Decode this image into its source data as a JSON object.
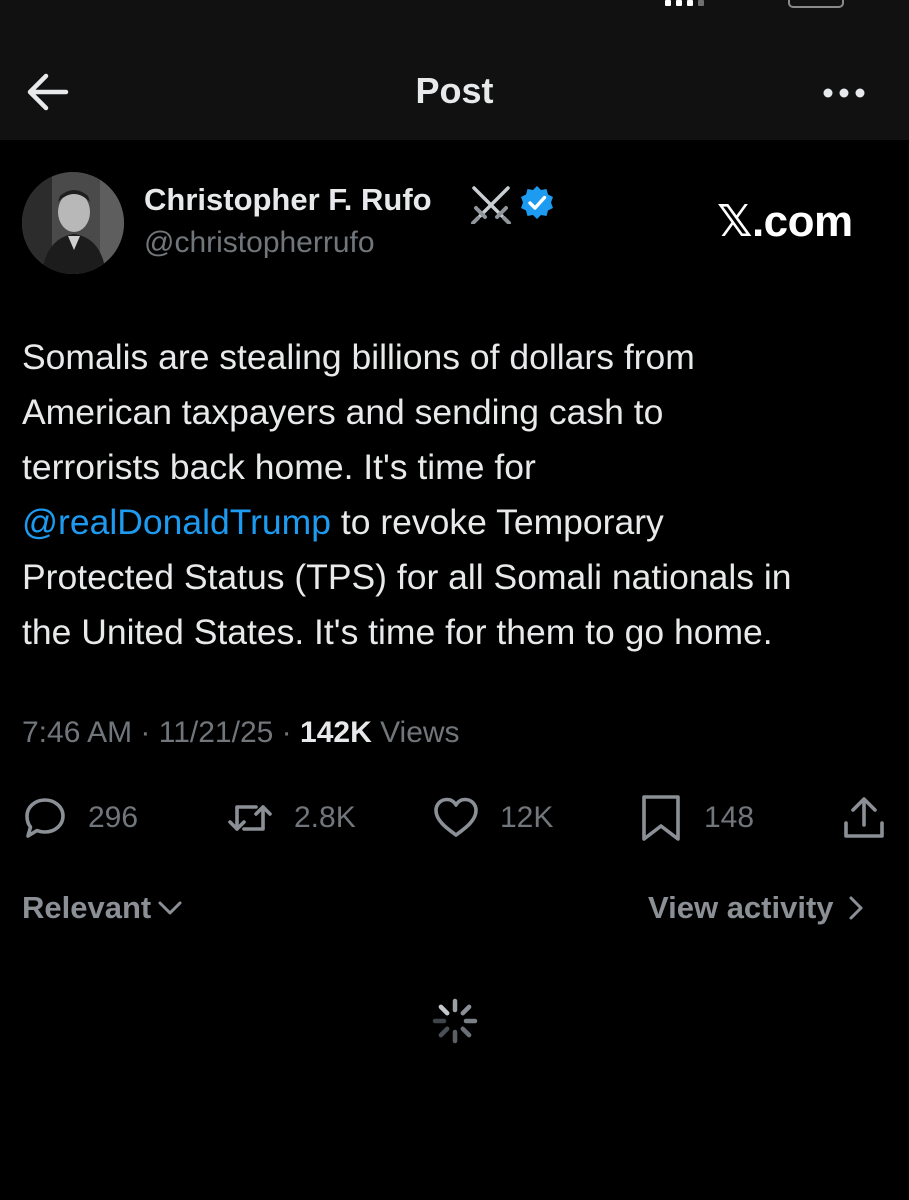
{
  "header": {
    "title": "Post"
  },
  "post": {
    "author": {
      "name": "Christopher F. Rufo",
      "handle": "@christopherrufo"
    },
    "watermark": "𝕏.com",
    "body_lines": [
      "Somalis are stealing billions of dollars from",
      "American taxpayers and sending cash to",
      "terrorists back home. It's time for",
      {
        "mention": "@realDonaldTrump",
        "rest": " to revoke Temporary"
      },
      "Protected Status (TPS) for all Somali nationals in",
      "the United States. It's time for them to go home."
    ],
    "meta": {
      "time": "7:46 AM",
      "separator": "·",
      "date": "11/21/25",
      "views_count": "142K",
      "views_label": "Views"
    },
    "actions": {
      "replies": "296",
      "reposts": "2.8K",
      "likes": "12K",
      "bookmarks": "148"
    }
  },
  "replies_section": {
    "sort_label": "Relevant",
    "view_activity_label": "View activity"
  },
  "colors": {
    "background": "#000000",
    "header_background": "#111112",
    "primary_text": "#e7e9ea",
    "secondary_text": "#71767b",
    "link": "#1d9bf0",
    "verified": "#1d9bf0"
  },
  "icons": {
    "back": "arrow-left-icon",
    "more": "more-horizontal-icon",
    "badge": "crossed-swords-icon",
    "verified": "verified-badge-icon",
    "reply": "reply-icon",
    "repost": "repost-icon",
    "like": "heart-icon",
    "bookmark": "bookmark-icon",
    "share": "share-icon",
    "sort": "chevron-down-icon",
    "activity": "chevron-right-icon",
    "loading": "loading-spinner-icon"
  }
}
